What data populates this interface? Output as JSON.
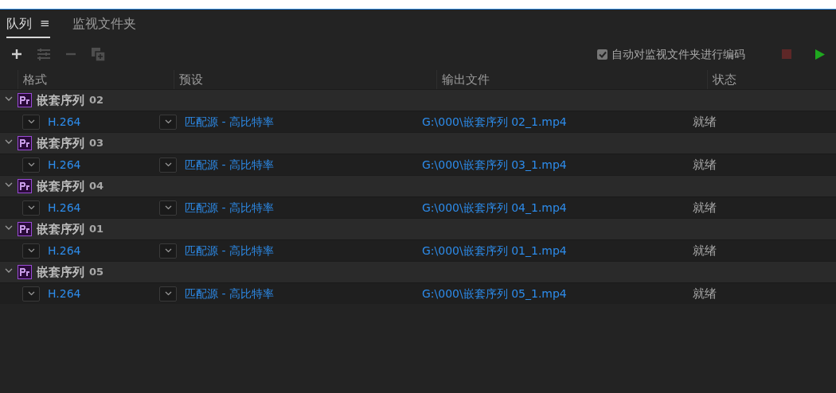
{
  "tabs": [
    {
      "label": "队列",
      "menu": "≡",
      "selected": true
    },
    {
      "label": "监视文件夹",
      "selected": false
    }
  ],
  "toolbar": [
    {
      "kind": "add",
      "disabled": false
    },
    {
      "kind": "settings",
      "disabled": true
    },
    {
      "kind": "remove",
      "disabled": true
    },
    {
      "kind": "duplicate",
      "disabled": true
    }
  ],
  "auto_encode": {
    "label": "自动对监视文件夹进行编码",
    "checked": true
  },
  "controls": [
    {
      "kind": "stop",
      "disabled": true
    },
    {
      "kind": "start",
      "disabled": false
    }
  ],
  "table": {
    "columns": [
      "格式",
      "预设",
      "输出文件",
      "状态"
    ],
    "groups": [
      {
        "name": "嵌套序列",
        "number": "02",
        "expanded": true,
        "items": [
          {
            "format": "H.264",
            "preset": "匹配源 - 高比特率",
            "output": "G:\\000\\嵌套序列 02_1.mp4",
            "status": "就绪"
          }
        ]
      },
      {
        "name": "嵌套序列",
        "number": "03",
        "expanded": true,
        "items": [
          {
            "format": "H.264",
            "preset": "匹配源 - 高比特率",
            "output": "G:\\000\\嵌套序列 03_1.mp4",
            "status": "就绪"
          }
        ]
      },
      {
        "name": "嵌套序列",
        "number": "04",
        "expanded": true,
        "items": [
          {
            "format": "H.264",
            "preset": "匹配源 - 高比特率",
            "output": "G:\\000\\嵌套序列 04_1.mp4",
            "status": "就绪"
          }
        ]
      },
      {
        "name": "嵌套序列",
        "number": "01",
        "expanded": true,
        "items": [
          {
            "format": "H.264",
            "preset": "匹配源 - 高比特率",
            "output": "G:\\000\\嵌套序列 01_1.mp4",
            "status": "就绪"
          }
        ]
      },
      {
        "name": "嵌套序列",
        "number": "05",
        "expanded": true,
        "items": [
          {
            "format": "H.264",
            "preset": "匹配源 - 高比特率",
            "output": "G:\\000\\嵌套序列 05_1.mp4",
            "status": "就绪"
          }
        ]
      }
    ]
  }
}
